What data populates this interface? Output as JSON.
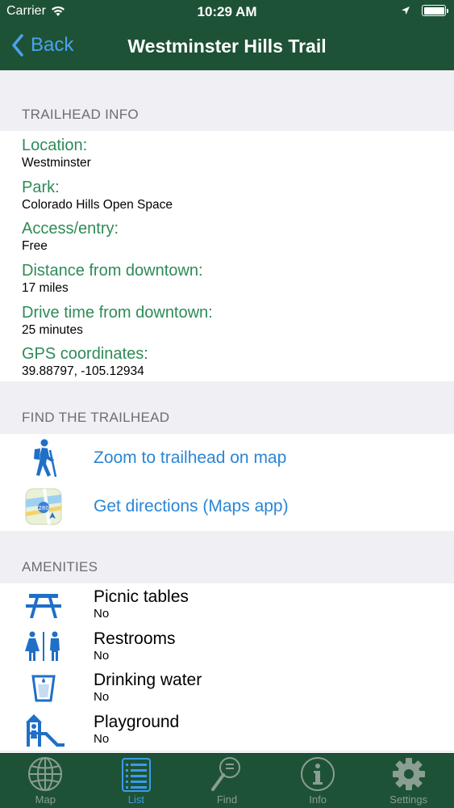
{
  "status": {
    "carrier": "Carrier",
    "time": "10:29 AM"
  },
  "nav": {
    "back_label": "Back",
    "title": "Westminster Hills Trail"
  },
  "trailhead_info": {
    "header": "TRAILHEAD INFO",
    "rows": [
      {
        "label": "Location:",
        "value": "Westminster"
      },
      {
        "label": "Park:",
        "value": "Colorado Hills Open Space"
      },
      {
        "label": "Access/entry:",
        "value": "Free"
      },
      {
        "label": "Distance from downtown:",
        "value": "17 miles"
      },
      {
        "label": "Drive time from downtown:",
        "value": "25 minutes"
      },
      {
        "label": "GPS coordinates:",
        "value": "39.88797, -105.12934"
      }
    ]
  },
  "find_trailhead": {
    "header": "FIND THE TRAILHEAD",
    "zoom_label": "Zoom to trailhead on map",
    "directions_label": "Get directions (Maps app)"
  },
  "amenities": {
    "header": "AMENITIES",
    "items": [
      {
        "name": "Picnic tables",
        "value": "No",
        "icon": "picnic-table-icon"
      },
      {
        "name": "Restrooms",
        "value": "No",
        "icon": "restroom-icon"
      },
      {
        "name": "Drinking water",
        "value": "No",
        "icon": "drinking-water-icon"
      },
      {
        "name": "Playground",
        "value": "No",
        "icon": "playground-icon"
      }
    ]
  },
  "tabs": [
    {
      "label": "Map",
      "icon": "globe-icon",
      "active": false
    },
    {
      "label": "List",
      "icon": "list-icon",
      "active": true
    },
    {
      "label": "Find",
      "icon": "magnifier-icon",
      "active": false
    },
    {
      "label": "Info",
      "icon": "info-icon",
      "active": false
    },
    {
      "label": "Settings",
      "icon": "gear-icon",
      "active": false
    }
  ],
  "colors": {
    "nav_bg": "#1e5236",
    "label_green": "#2e8b57",
    "link_blue": "#2a86d6",
    "active_tab": "#3a9bea"
  }
}
